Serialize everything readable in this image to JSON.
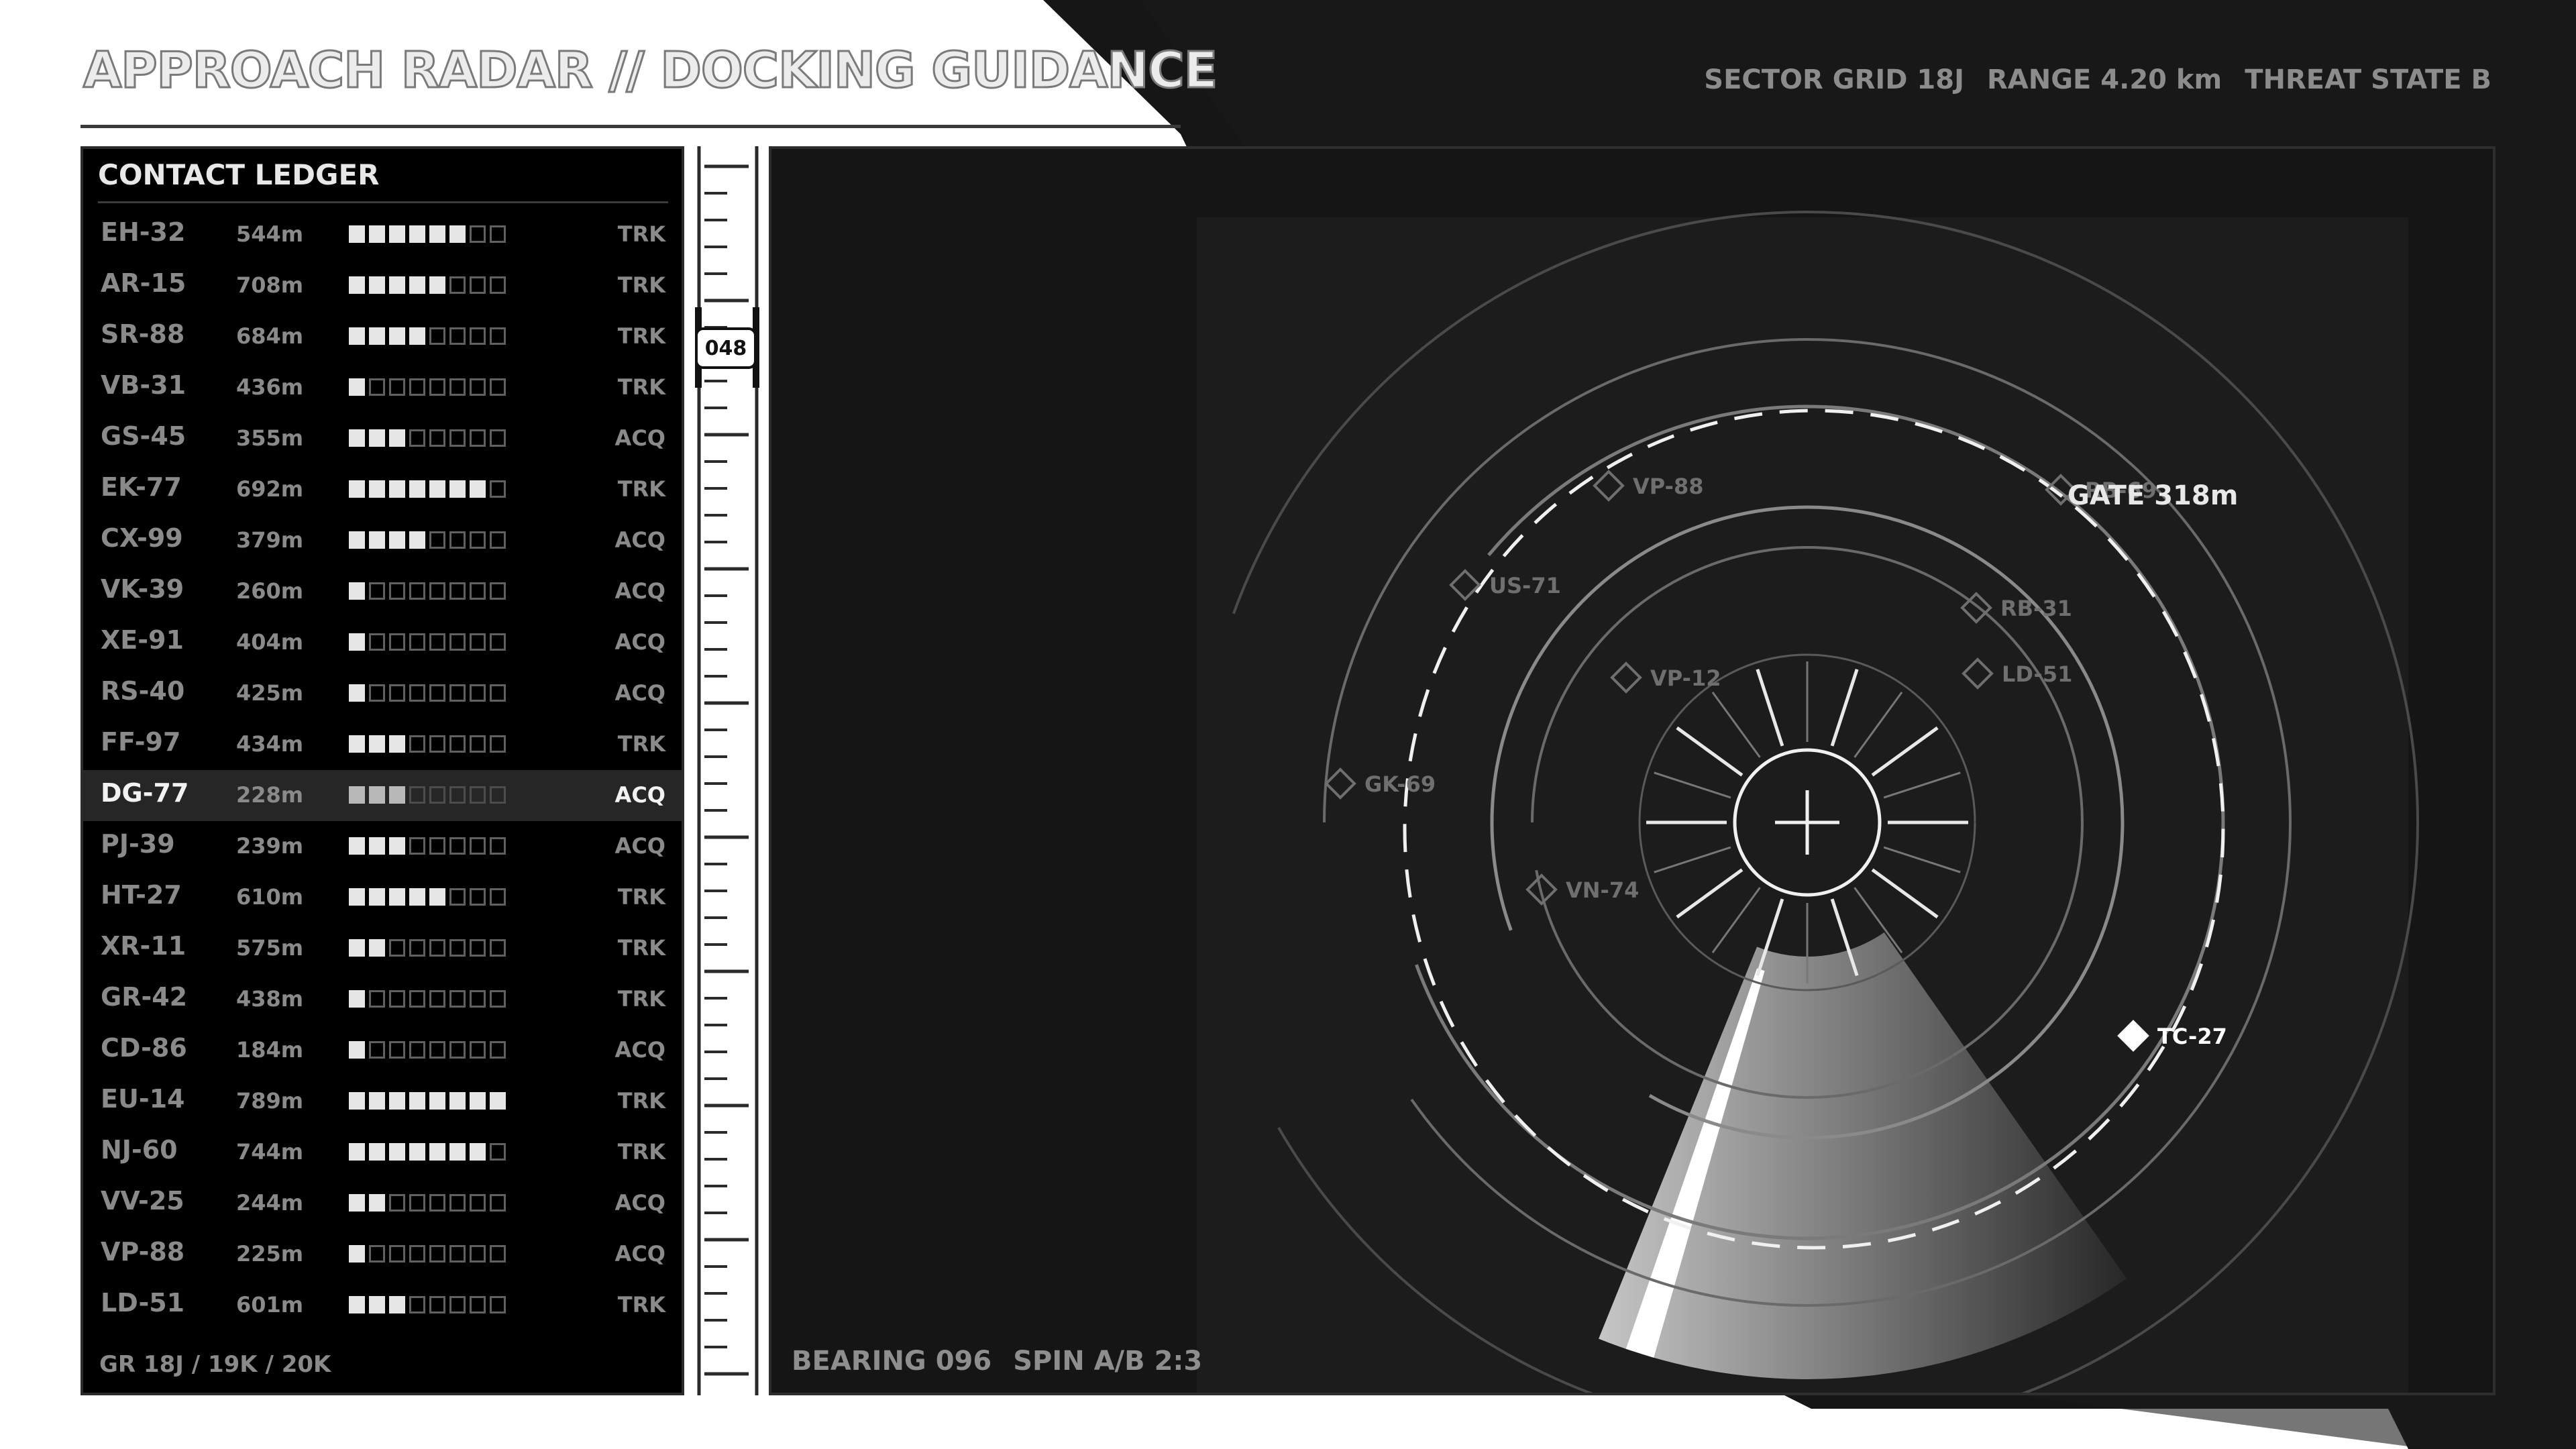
{
  "header": {
    "title": "APPROACH RADAR // DOCKING GUIDANCE",
    "sector": "SECTOR GRID 18J",
    "range": "RANGE 4.20 km",
    "threat": "THREAT STATE B"
  },
  "ledger": {
    "title": "CONTACT LEDGER",
    "footer": "GR 18J / 19K / 20K",
    "selected_index": 11,
    "rows": [
      {
        "id": "EH-32",
        "range": "544m",
        "signal": 6,
        "status": "TRK"
      },
      {
        "id": "AR-15",
        "range": "708m",
        "signal": 5,
        "status": "TRK"
      },
      {
        "id": "SR-88",
        "range": "684m",
        "signal": 4,
        "status": "TRK"
      },
      {
        "id": "VB-31",
        "range": "436m",
        "signal": 1,
        "status": "TRK"
      },
      {
        "id": "GS-45",
        "range": "355m",
        "signal": 3,
        "status": "ACQ"
      },
      {
        "id": "EK-77",
        "range": "692m",
        "signal": 7,
        "status": "TRK"
      },
      {
        "id": "CX-99",
        "range": "379m",
        "signal": 4,
        "status": "ACQ"
      },
      {
        "id": "VK-39",
        "range": "260m",
        "signal": 1,
        "status": "ACQ"
      },
      {
        "id": "XE-91",
        "range": "404m",
        "signal": 1,
        "status": "ACQ"
      },
      {
        "id": "RS-40",
        "range": "425m",
        "signal": 1,
        "status": "ACQ"
      },
      {
        "id": "FF-97",
        "range": "434m",
        "signal": 3,
        "status": "TRK"
      },
      {
        "id": "DG-77",
        "range": "228m",
        "signal": 3,
        "status": "ACQ"
      },
      {
        "id": "PJ-39",
        "range": "239m",
        "signal": 3,
        "status": "ACQ"
      },
      {
        "id": "HT-27",
        "range": "610m",
        "signal": 5,
        "status": "TRK"
      },
      {
        "id": "XR-11",
        "range": "575m",
        "signal": 2,
        "status": "TRK"
      },
      {
        "id": "GR-42",
        "range": "438m",
        "signal": 1,
        "status": "TRK"
      },
      {
        "id": "CD-86",
        "range": "184m",
        "signal": 1,
        "status": "ACQ"
      },
      {
        "id": "EU-14",
        "range": "789m",
        "signal": 8,
        "status": "TRK"
      },
      {
        "id": "NJ-60",
        "range": "744m",
        "signal": 7,
        "status": "TRK"
      },
      {
        "id": "VV-25",
        "range": "244m",
        "signal": 2,
        "status": "ACQ"
      },
      {
        "id": "VP-88",
        "range": "225m",
        "signal": 1,
        "status": "ACQ"
      },
      {
        "id": "LD-51",
        "range": "601m",
        "signal": 3,
        "status": "TRK"
      }
    ],
    "signal_max": 8
  },
  "scale": {
    "readout": "048"
  },
  "radar": {
    "gate_label": "GATE 318m",
    "bearing": "BEARING 096",
    "spin": "SPIN A/B 2:3",
    "sweep_bearing_deg": 96,
    "contacts": [
      {
        "label": "VP-88",
        "selected": false
      },
      {
        "label": "RB-69",
        "selected": false
      },
      {
        "label": "US-71",
        "selected": false
      },
      {
        "label": "RB-31",
        "selected": false
      },
      {
        "label": "LD-51",
        "selected": false
      },
      {
        "label": "VP-12",
        "selected": false
      },
      {
        "label": "GK-69",
        "selected": false
      },
      {
        "label": "VN-74",
        "selected": false
      },
      {
        "label": "TC-27",
        "selected": true
      }
    ],
    "colors": {
      "background": "#1c1c1c",
      "ring": "#8a8a8a",
      "contact": "#6f6f6f",
      "highlight": "#ffffff"
    }
  },
  "colors": {
    "title_fill": "#ececec",
    "muted_text": "#8a8a8a",
    "ledger_bg": "#000000",
    "selected_row": "#262626"
  }
}
